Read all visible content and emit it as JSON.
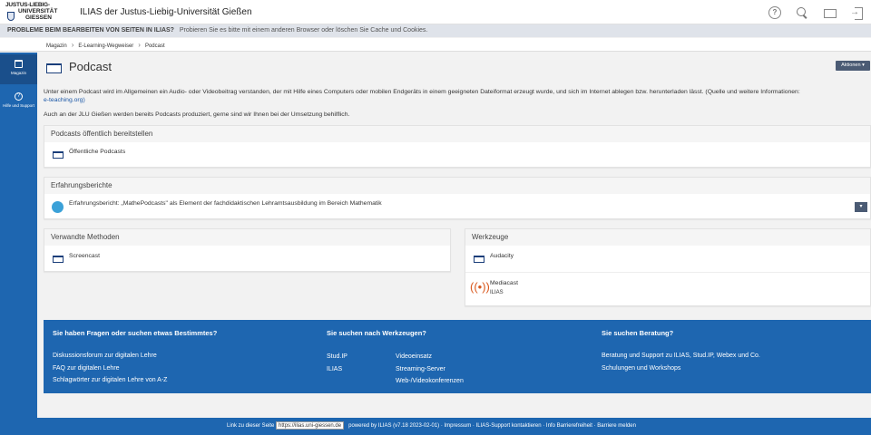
{
  "header": {
    "logo": {
      "line1": "JUSTUS-LIEBIG-",
      "line2": "UNIVERSITÄT",
      "line3": "GIESSEN"
    },
    "title": "ILIAS der Justus-Liebig-Universität Gießen",
    "icons": [
      "help-icon",
      "search-icon",
      "screen-icon",
      "login-icon"
    ]
  },
  "banner": {
    "bold": "PROBLEME BEIM BEARBEITEN VON SEITEN IN ILIAS?",
    "text": "Probieren Sie es bitte mit einem anderen Browser oder löschen Sie Cache und Cookies."
  },
  "breadcrumb": [
    "Magazin",
    "E-Learning-Wegweiser",
    "Podcast"
  ],
  "sidenav": [
    {
      "label": "Magazin",
      "icon": "bank-icon"
    },
    {
      "label": "Hilfe und Support",
      "icon": "help-icon"
    }
  ],
  "page": {
    "title": "Podcast",
    "actions_label": "Aktionen ▾",
    "intro1": "Unter einem Podcast wird im Allgemeinen ein Audio- oder Videobeitrag verstanden, der mit Hilfe eines Computers oder mobilen Endgeräts in einem geeigneten Dateiformat erzeugt wurde, und sich im Internet ablegen bzw. herunterladen lässt. (Quelle und weitere Informationen:",
    "intro1_link": "e-teaching.org)",
    "intro2": "Auch an der JLU Gießen werden bereits Podcasts produziert, gerne sind wir Ihnen bei der Umsetzung behilflich."
  },
  "panels": {
    "publish": {
      "title": "Podcasts öffentlich bereitstellen",
      "item": "Öffentliche Podcasts"
    },
    "reports": {
      "title": "Erfahrungsberichte",
      "item": "Erfahrungsbericht: „MathePodcasts\" als Element der fachdidaktischen Lehramtsausbildung im Bereich Mathematik"
    },
    "methods": {
      "title": "Verwandte Methoden",
      "item": "Screencast"
    },
    "tools": {
      "title": "Werkzeuge",
      "item1": "Audacity",
      "item2": "Mediacast",
      "item2_sub": "ILIAS"
    }
  },
  "footer": {
    "col1": {
      "heading": "Sie haben Fragen oder suchen etwas Bestimmtes?",
      "links": [
        "Diskussionsforum zur digitalen Lehre",
        "FAQ zur digitalen Lehre",
        "Schlagwörter zur digitalen Lehre von A-Z"
      ]
    },
    "col2": {
      "heading": "Sie suchen nach Werkzeugen?",
      "links_a": [
        "Stud.IP",
        "ILIAS"
      ],
      "links_b": [
        "Videoeinsatz",
        "Streaming-Server",
        "Web-/Videokonferenzen"
      ]
    },
    "col3": {
      "heading": "Sie suchen Beratung?",
      "links": [
        "Beratung und Support zu ILIAS, Stud.IP, Webex und Co.",
        "Schulungen und Workshops"
      ]
    }
  },
  "bottombar": {
    "link_label": "Link zu dieser Seite",
    "url": "https://ilias.uni-giessen.de",
    "powered": "powered by ILIAS (v7.18 2023-02-01)",
    "links": [
      "Impressum",
      "ILIAS-Support kontaktieren",
      "Info Barrierefreiheit",
      "Barriere melden"
    ]
  }
}
